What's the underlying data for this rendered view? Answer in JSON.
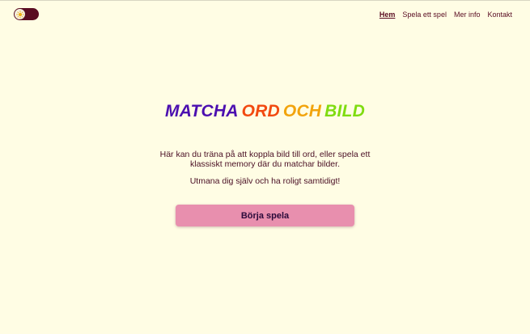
{
  "theme_toggle": {
    "icon": "sun-icon",
    "state": "light"
  },
  "nav": {
    "items": [
      {
        "label": "Hem",
        "active": true
      },
      {
        "label": "Spela ett spel",
        "active": false
      },
      {
        "label": "Mer info",
        "active": false
      },
      {
        "label": "Kontakt",
        "active": false
      }
    ]
  },
  "hero": {
    "title_words": [
      "MATCHA",
      "ORD",
      "OCH",
      "BILD"
    ],
    "title_colors": [
      "#4b0fb0",
      "#f24a10",
      "#f2a40c",
      "#7fdc10"
    ],
    "description": "Här kan du träna på att koppla bild till ord, eller spela ett klassiskt memory där du matchar bilder.",
    "tagline": "Utmana dig själv och ha roligt samtidigt!",
    "cta_label": "Börja spela"
  },
  "colors": {
    "background": "#fffde4",
    "text": "#4a0f24",
    "button": "#e88fae",
    "toggle": "#5a0d22"
  }
}
